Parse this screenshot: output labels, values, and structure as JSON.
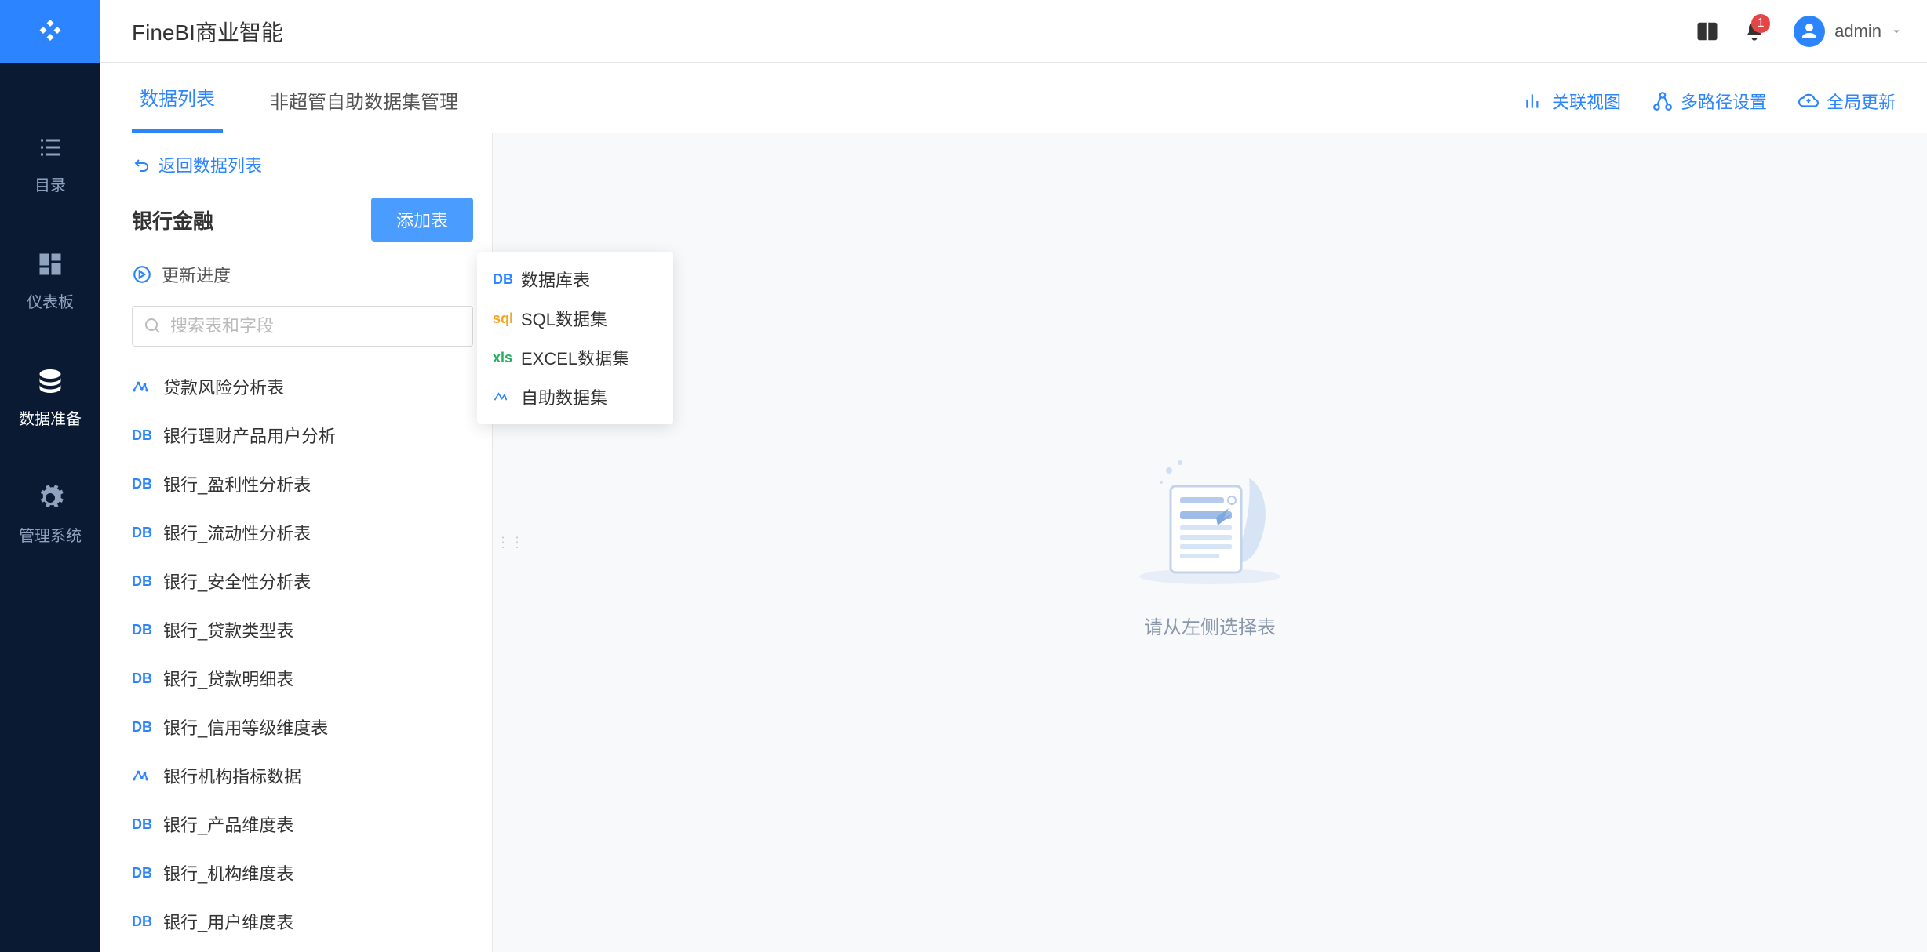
{
  "app": {
    "title": "FineBI商业智能"
  },
  "topbar": {
    "notification_count": "1",
    "user_name": "admin"
  },
  "sidenav": {
    "items": [
      {
        "label": "目录"
      },
      {
        "label": "仪表板"
      },
      {
        "label": "数据准备"
      },
      {
        "label": "管理系统"
      }
    ]
  },
  "tabs": [
    {
      "label": "数据列表"
    },
    {
      "label": "非超管自助数据集管理"
    }
  ],
  "tab_actions": [
    {
      "label": "关联视图"
    },
    {
      "label": "多路径设置"
    },
    {
      "label": "全局更新"
    }
  ],
  "panel": {
    "back_label": "返回数据列表",
    "title": "银行金融",
    "add_button": "添加表",
    "progress_label": "更新进度",
    "search_placeholder": "搜索表和字段"
  },
  "add_menu": [
    {
      "icon": "db",
      "icon_text": "DB",
      "label": "数据库表"
    },
    {
      "icon": "sql",
      "icon_text": "sql",
      "label": "SQL数据集"
    },
    {
      "icon": "xls",
      "icon_text": "xls",
      "label": "EXCEL数据集"
    },
    {
      "icon": "self",
      "icon_text": "✦",
      "label": "自助数据集"
    }
  ],
  "tables": [
    {
      "type": "self",
      "name": "贷款风险分析表"
    },
    {
      "type": "db",
      "name": "银行理财产品用户分析"
    },
    {
      "type": "db",
      "name": "银行_盈利性分析表"
    },
    {
      "type": "db",
      "name": "银行_流动性分析表"
    },
    {
      "type": "db",
      "name": "银行_安全性分析表"
    },
    {
      "type": "db",
      "name": "银行_贷款类型表"
    },
    {
      "type": "db",
      "name": "银行_贷款明细表"
    },
    {
      "type": "db",
      "name": "银行_信用等级维度表"
    },
    {
      "type": "self",
      "name": "银行机构指标数据"
    },
    {
      "type": "db",
      "name": "银行_产品维度表"
    },
    {
      "type": "db",
      "name": "银行_机构维度表"
    },
    {
      "type": "db",
      "name": "银行_用户维度表"
    }
  ],
  "empty_state": {
    "text": "请从左侧选择表"
  }
}
